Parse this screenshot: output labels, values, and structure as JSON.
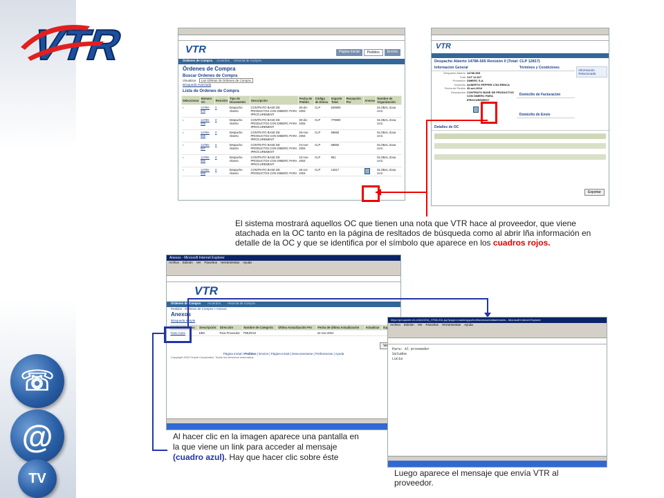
{
  "brand": {
    "logo_text": "VTR"
  },
  "sidebar_icons": [
    "phone-icon",
    "at-sign-icon",
    "tv-icon"
  ],
  "shot1": {
    "page_title": "Órdenes de Compra",
    "search_title": "Buscar Ordenes de Compra",
    "view_label": "Visualizar",
    "view_value": "Las Últimas 25 Ordenes de Compra",
    "advanced_search": "Búsqueda Avanzada",
    "list_title": "Lista de Ordenes de Compra",
    "tabs": [
      "Órdenes de Compra",
      "Acuerdos",
      "Historial de Compra"
    ],
    "top_tabs": [
      "Página Inicial",
      "Pedidos",
      "Envíos"
    ],
    "columns": [
      "Seleccionar",
      "Número OC",
      "Revisión",
      "Tipo de Documento",
      "Descripción",
      "Fecha de Pedido",
      "Código de Divisa",
      "Importe Total",
      "Recepción Por",
      "Anexos",
      "Nombre de Organización"
    ],
    "rows": [
      {
        "num": "14786-570",
        "rev": "0",
        "tipo": "Despacho Abierto",
        "desc": "CONTRATO BASE DE PRODUCTOS CON DIMERC PARA IPROCUREMENT",
        "fecha": "30-dic-2004",
        "div": "CLP",
        "total": "529900",
        "org": "GLOBAL Zona UAC"
      },
      {
        "num": "14786-569",
        "rev": "0",
        "tipo": "Despacho Abierto",
        "desc": "CONTRATO BASE DE PRODUCTOS CON DIMERC PARA IPROCUREMENT",
        "fecha": "30-dic-2004",
        "div": "CLP",
        "total": "779900",
        "org": "GLOBAL Zona UAC"
      },
      {
        "num": "14786-568",
        "rev": "0",
        "tipo": "Despacho Abierto",
        "desc": "CONTRATO BASE DE PRODUCTOS CON DIMERC PARA IPROCUREMENT",
        "fecha": "26-nov-2004",
        "div": "CLP",
        "total": "59660",
        "org": "GLOBAL Zona UAC"
      },
      {
        "num": "14786-567",
        "rev": "0",
        "tipo": "Despacho Abierto",
        "desc": "CONTRATO BASE DE PRODUCTOS CON DIMERC PARA IPROCUREMENT",
        "fecha": "24-nov-2004",
        "div": "CLP",
        "total": "59660",
        "org": "GLOBAL Zona UAC"
      },
      {
        "num": "14786-566",
        "rev": "0",
        "tipo": "Despacho Abierto",
        "desc": "CONTRATO BASE DE PRODUCTOS CON DIMERC PARA IPROCUREMENT",
        "fecha": "22-nov-2004",
        "div": "CLP",
        "total": "961",
        "org": "GLOBAL Zona UAC"
      },
      {
        "num": "14786-565",
        "rev": "0",
        "tipo": "Despacho Abierto",
        "desc": "CONTRATO BASE DE PRODUCTOS CON DIMERC PARA",
        "fecha": "25-oct-2004",
        "div": "CLP",
        "total": "12817",
        "org": "GLOBAL Zona UAC"
      }
    ]
  },
  "shot2": {
    "title": "Despacho Abierto 14786-565 Revisión 0 (Total: CLP 12817)",
    "section1": "Información General",
    "section2": "Términos y Condiciones",
    "section3": "Domicilio de Facturación",
    "section4": "Domicilio de Envío",
    "section5": "Detalles de OC",
    "side_box": "Información Relacionada",
    "export_button": "Exportar",
    "fields": [
      [
        "Despacho Abierto",
        "14786-565"
      ],
      [
        "Total",
        "CLP 12.817"
      ],
      [
        "Proveedor",
        "DIMERC S.A."
      ],
      [
        "Domicilio",
        "ALBERTO PEPPER 1784 RENCA"
      ],
      [
        "Fecha de Pedido",
        "25-oct-2004"
      ],
      [
        "Descripción",
        "CONTRATO BASE DE PRODUCTOS CON DIMERC PARA IPROCUREMENT"
      ]
    ]
  },
  "shot3": {
    "window_title": "Anexos - Microsoft Internet Explorer",
    "menu": [
      "Archivo",
      "Edición",
      "Ver",
      "Favoritos",
      "Herramientas",
      "Ayuda"
    ],
    "crumb": "Pedidos : Órdenes de Compra > Anexos",
    "page_title": "Anexos",
    "simple_search": "Búsqueda Simple",
    "columns": [
      "Nombre de Datos",
      "Descripción",
      "Dirección",
      "Nombre de Categoría",
      "Última Actualización Por",
      "Fecha de Última Actualización",
      "Actualizar",
      "Suprimir"
    ],
    "row": {
      "name": "Texto Corto",
      "desc": "EBS",
      "dir": "Para Proveedor",
      "cat": "PMUROZ",
      "date": "22-nov-2004"
    },
    "back_button": "Volver",
    "footer_links": [
      "Página Inicial",
      "Pedidos",
      "Envíos",
      "Página Inicial",
      "Desconectarse",
      "Preferencias",
      "Ayuda"
    ],
    "copyright": "Copyright 2003 Oracle Corporation. Todos los derechos reservados.",
    "tabs": [
      "Órdenes de Compra",
      "Acuerdos",
      "Historial de Compra"
    ]
  },
  "shot4": {
    "window_title": "https://pmupweb.vtr.cl:8443/OA_HTML/OA.jsp?page=/oracle/apps/fnd/framework/attachments - Microsoft Internet Explorer",
    "menu": [
      "Archivo",
      "Edición",
      "Ver",
      "Favoritos",
      "Herramientas",
      "Ayuda"
    ],
    "body_lines": [
      "Para: Al proveedor",
      "Saludos",
      "Lucía"
    ]
  },
  "captions": {
    "c1_text": "El sistema mostrará aquellos OC que tienen una nota que VTR hace al proveedor, que viene atachada en la OC tanto en la página de resltados de búsqueda como al abrir lña información en detalle de la OC y que se identifica por el símbolo que aparece en los ",
    "c1_highlight": "cuadros rojos.",
    "c2_text": "Al hacer clic en la imagen aparece una pantalla en la que viene un link para acceder al mensaje ",
    "c2_highlight": "(cuadro azul).",
    "c2_text2": " Hay que hacer clic sobre éste",
    "c3_text": "Luego aparece el mensaje que envía VTR al proveedor."
  },
  "colors": {
    "red": "#e00000",
    "blue": "#2233aa",
    "oracle_blue": "#1d3f8a"
  }
}
